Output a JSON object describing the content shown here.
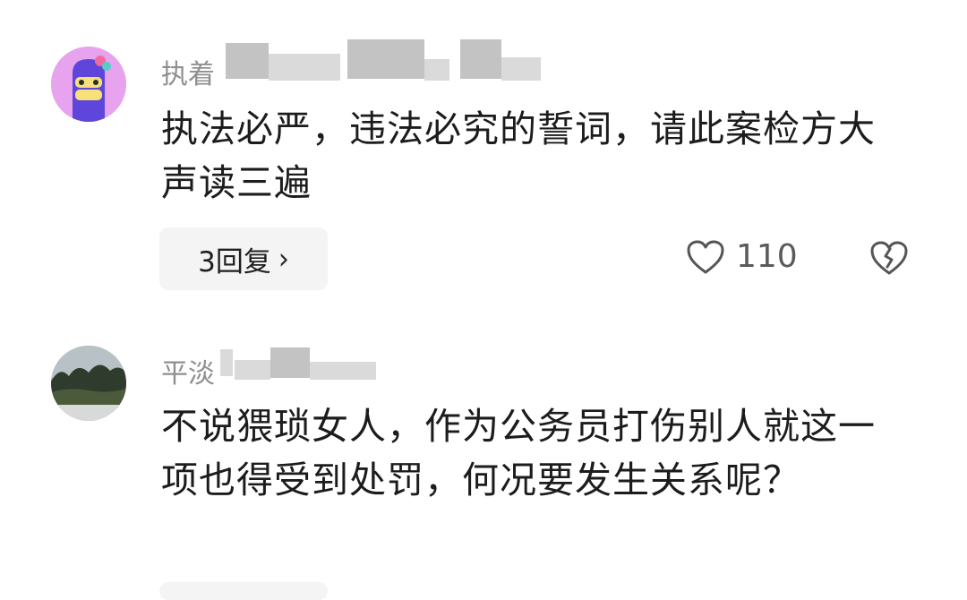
{
  "comments": [
    {
      "username": "执着",
      "text": "执法必严，违法必究的誓词，请此案检方大声读三遍",
      "reply_label": "3回复",
      "like_count": "110"
    },
    {
      "username": "平淡",
      "text": "不说猥琐女人，作为公务员打伤别人就这一项也得受到处罚，何况要发生关系呢？"
    }
  ]
}
